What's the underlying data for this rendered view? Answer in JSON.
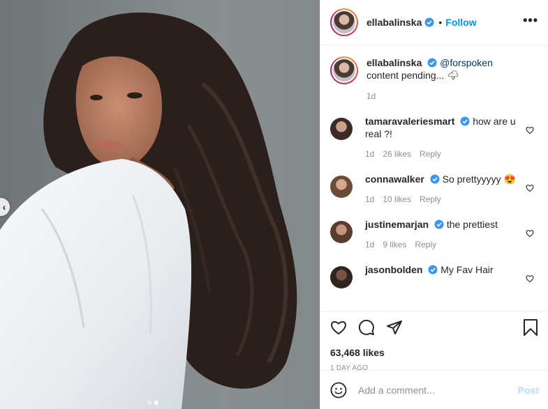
{
  "post": {
    "author": "ellabalinska",
    "follow_label": "Follow",
    "separator": "•",
    "more_label": "•••"
  },
  "caption": {
    "username": "ellabalinska",
    "mention": "@forspoken",
    "text": " content pending... 🌩",
    "age": "1d"
  },
  "comments": [
    {
      "username": "tamaravaleriesmart",
      "text": "how are u real ?!",
      "age": "1d",
      "likes": "26 likes",
      "reply": "Reply",
      "avatar_color": "#3b2a26"
    },
    {
      "username": "connawalker",
      "text": "So prettyyyyy 😍",
      "age": "1d",
      "likes": "10 likes",
      "reply": "Reply",
      "avatar_color": "#6b4a3a"
    },
    {
      "username": "justinemarjan",
      "text": "the prettiest",
      "age": "1d",
      "likes": "9 likes",
      "reply": "Reply",
      "avatar_color": "#5a3b2e"
    },
    {
      "username": "jasonbolden",
      "text": "My Fav Hair",
      "avatar_color": "#2e2420"
    }
  ],
  "stats": {
    "likes": "63,468 likes",
    "time": "1 DAY AGO"
  },
  "composer": {
    "placeholder": "Add a comment...",
    "post_label": "Post"
  },
  "colors": {
    "link_blue": "#0095f6",
    "verified_blue": "#3897f0",
    "muted": "#8e8e8e"
  },
  "icons": [
    "heart-icon",
    "comment-icon",
    "share-icon",
    "bookmark-icon",
    "emoji-icon",
    "more-icon",
    "verified-icon",
    "chevron-left-icon"
  ]
}
